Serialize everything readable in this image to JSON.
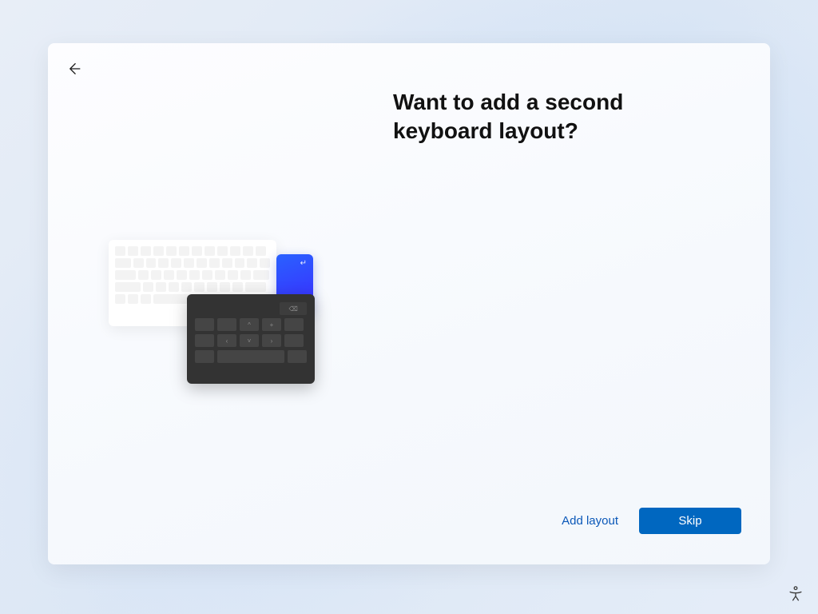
{
  "header": {
    "title": "Want to add a second keyboard layout?"
  },
  "footer": {
    "add_layout_label": "Add layout",
    "skip_label": "Skip"
  },
  "icons": {
    "back": "back-arrow-icon",
    "accessibility": "accessibility-figure-icon"
  },
  "colors": {
    "primary": "#0067c0",
    "link": "#0a58b8"
  }
}
